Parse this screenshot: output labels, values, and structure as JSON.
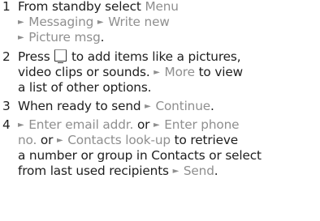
{
  "steps": [
    {
      "number": "1",
      "prefix": "From standby select",
      "menu": "Menu",
      "messaging": "Messaging",
      "write_new": "Write new",
      "picture_msg": "Picture msg",
      "end": "."
    },
    {
      "number": "2",
      "press": "Press",
      "key_icon": "selection-key-icon",
      "text_a": " to add items like a pictures,",
      "text_b": "video clips or sounds. ",
      "more": "More",
      "text_c": " to view",
      "text_d": "a list of other options."
    },
    {
      "number": "3",
      "text": "When ready to send ",
      "continue_label": "Continue",
      "end": "."
    },
    {
      "number": "4",
      "enter_email": "Enter email addr.",
      "or1": " or ",
      "enter_phone_a": "Enter phone",
      "enter_phone_b": "no.",
      "or2": " or ",
      "contacts_lookup": "Contacts look-up",
      "text_a": " to retrieve",
      "text_b": "a number or group in Contacts or select",
      "text_c": "from last used recipients ",
      "send": "Send",
      "end": "."
    }
  ],
  "arrow_glyph": "►",
  "colors": {
    "text": "#1e1e1e",
    "highlight": "#8f8f8f"
  }
}
